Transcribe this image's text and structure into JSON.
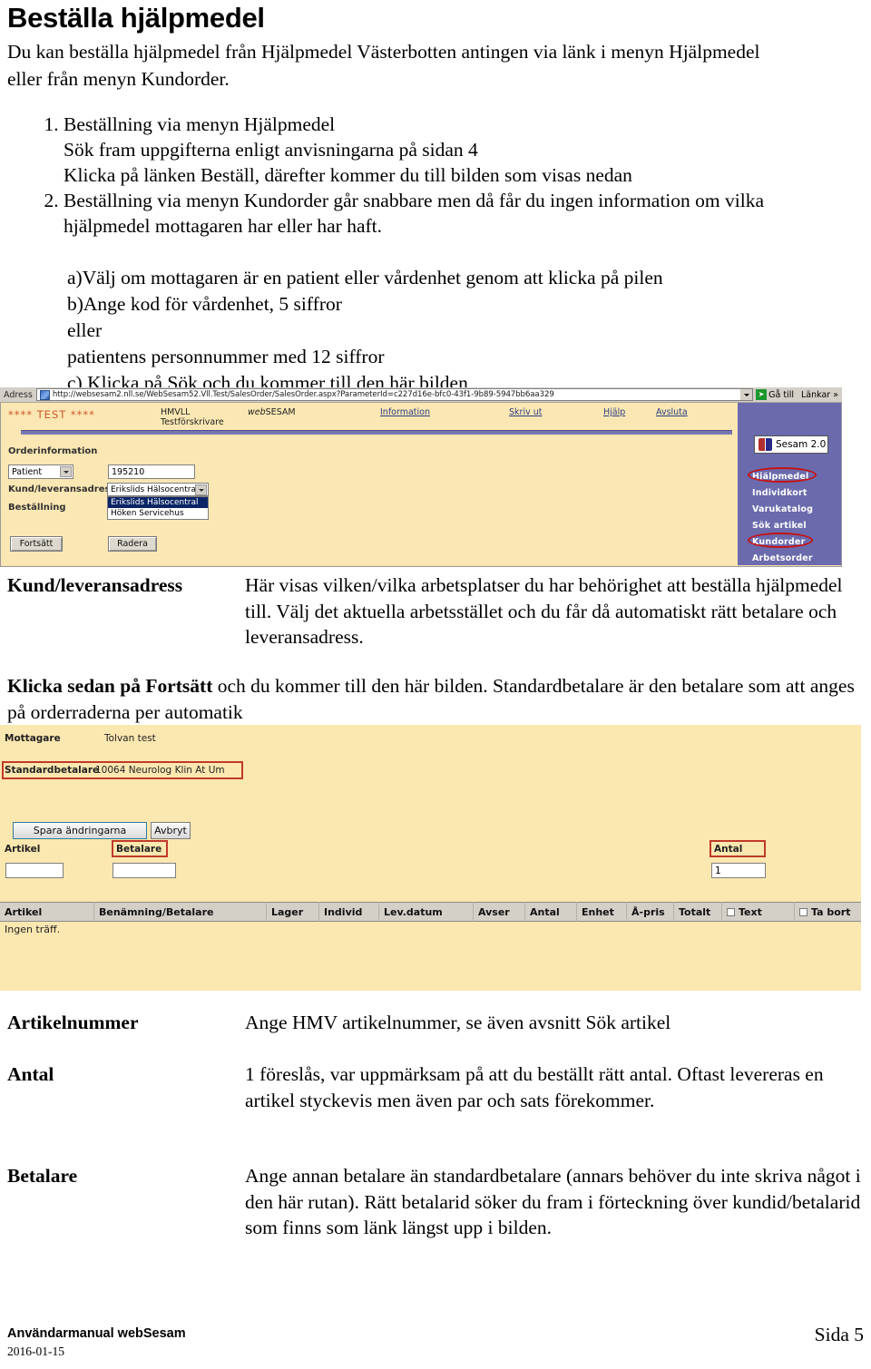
{
  "document": {
    "title": "Beställa hjälpmedel",
    "intro": "Du kan beställa hjälpmedel från Hjälpmedel Västerbotten antingen via länk i menyn Hjälpmedel eller från menyn Kundorder.",
    "steps": [
      {
        "main": "Beställning via menyn Hjälpmedel",
        "sub": [
          "Sök fram uppgifterna enligt anvisningarna på sidan 4",
          "Klicka på länken Beställ, därefter kommer du till bilden som visas nedan"
        ]
      },
      {
        "main": "Beställning via menyn Kundorder går snabbare men då får du ingen information om vilka hjälpmedel mottagaren har eller har haft.",
        "sub": []
      }
    ],
    "abc_list": [
      "a)Välj om mottagaren är en patient eller vårdenhet genom att klicka på pilen",
      "b)Ange kod för vårdenhet, 5 siffror",
      "eller",
      "patientens personnummer med 12 siffror",
      "c) Klicka på Sök och du kommer till den här bilden"
    ],
    "explanations": [
      {
        "label": "Kund/leveransadress",
        "body": "Här visas vilken/vilka arbetsplatser du har behörighet att beställa hjälpmedel till. Välj det aktuella arbetsstället och du får då automatiskt rätt betalare och leveransadress."
      },
      {
        "label": "Artikelnummer",
        "body": "Ange HMV artikelnummer, se även avsnitt Sök artikel"
      },
      {
        "label": "Antal",
        "body": "1 föreslås, var uppmärksam på att du beställt rätt antal. Oftast levereras en artikel styckevis men även par och sats förekommer."
      },
      {
        "label": "Betalare",
        "body": "Ange annan betalare än standardbetalare (annars behöver du inte skriva något i den här rutan). Rätt betalarid söker du fram i förteckning över kundid/betalarid som finns som länk längst upp i bilden."
      }
    ],
    "fortsatt_paragraph_bold": "Klicka sedan på Fortsätt",
    "fortsatt_paragraph_rest": " och du kommer till den här bilden. Standardbetalare är den betalare som att anges på orderraderna per automatik"
  },
  "footer": {
    "left": "Användarmanual webSesam",
    "date": "2016-01-15",
    "right": "Sida 5"
  },
  "screenshot1": {
    "browser": {
      "address_label": "Adress",
      "url": "http://websesam2.nll.se/WebSesam52.Vll.Test/SalesOrder/SalesOrder.aspx?ParameterId=c227d16e-bfc0-43f1-9b89-5947bb6aa329",
      "go_label": "Gå till",
      "links_label": "Länkar",
      "chevron": "»"
    },
    "header": {
      "test_marker": "**** TEST ****",
      "org": "HMVLL",
      "role": "Testförskrivare",
      "brand_prefix": "web",
      "brand_suffix": "SESAM",
      "nav": [
        {
          "label": "Information"
        },
        {
          "label": "Skriv ut"
        },
        {
          "label": "Hjälp"
        },
        {
          "label": "Avsluta"
        }
      ]
    },
    "logo": {
      "text": "Sesam 2.0"
    },
    "rail_items": [
      {
        "label": "Hjälpmedel",
        "highlighted": true
      },
      {
        "label": "Individkort",
        "highlighted": false
      },
      {
        "label": "Varukatalog",
        "highlighted": false
      },
      {
        "label": "Sök artikel",
        "highlighted": false
      },
      {
        "label": "Kundorder",
        "highlighted": true
      },
      {
        "label": "Arbetsorder",
        "highlighted": false
      }
    ],
    "form": {
      "section_title": "Orderinformation",
      "recipient_type": "Patient",
      "recipient_id": "195210",
      "kund_label": "Kund/leveransadress",
      "kund_selected": "Erikslids Hälsocentral",
      "kund_options": [
        "Erikslids Hälsocentral",
        "Höken Servicehus"
      ],
      "bestallning_label": "Beställning",
      "btn_continue": "Fortsätt",
      "btn_delete": "Radera"
    }
  },
  "screenshot2": {
    "mottagare_label": "Mottagare",
    "mottagare_value": "Tolvan test",
    "standardbetalare_label": "Standardbetalare",
    "standardbetalare_value": "10064 Neurolog Klin At Um",
    "btn_save": "Spara ändringarna",
    "btn_cancel": "Avbryt",
    "field_artikel_label": "Artikel",
    "field_artikel_value": "",
    "field_betalare_label": "Betalare",
    "field_betalare_value": "",
    "field_antal_label": "Antal",
    "field_antal_value": "1",
    "table": {
      "columns": [
        "Artikel",
        "Benämning/Betalare",
        "Lager",
        "Individ",
        "Lev.datum",
        "Avser",
        "Antal",
        "Enhet",
        "Å-pris",
        "Totalt",
        "Text",
        "Ta bort"
      ],
      "empty_message": "Ingen träff."
    }
  },
  "colors": {
    "sesam_background": "#fbe7b0",
    "sesam_rail": "#6a6ab0",
    "highlight_red": "#cc1111",
    "link_blue": "#2b3f86",
    "test_orange": "#d4562a",
    "table_header": "#d4d0c8"
  }
}
